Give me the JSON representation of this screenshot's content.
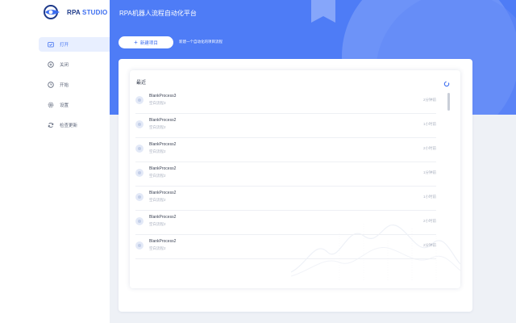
{
  "brand": {
    "name_main": "RPA",
    "name_accent": "STUDIO",
    "colors": {
      "primary": "#4e7cf6",
      "dark": "#1e3a8a",
      "accent": "#3b6df0"
    }
  },
  "sidebar": {
    "items": [
      {
        "label": "打开",
        "icon": "folder-open-icon",
        "active": true
      },
      {
        "label": "关闭",
        "icon": "close-circle-icon",
        "active": false
      },
      {
        "label": "开始",
        "icon": "clock-icon",
        "active": false
      },
      {
        "label": "设置",
        "icon": "gear-icon",
        "active": false
      },
      {
        "label": "检查更新",
        "icon": "sync-icon",
        "active": false
      }
    ]
  },
  "header": {
    "title": "RPA机器人流程自动化平台"
  },
  "toolbar": {
    "new_label": "新建项目",
    "new_hint": "新建一个自动化的项目流程"
  },
  "recent": {
    "title": "最近",
    "items": [
      {
        "name": "BlankProcess3",
        "sub": "空白流程3",
        "time": "2分钟前"
      },
      {
        "name": "BlankProcess2",
        "sub": "空白流程2",
        "time": "1小时前"
      },
      {
        "name": "BlankProcess2",
        "sub": "空白流程2",
        "time": "2小时前"
      },
      {
        "name": "BlankProcess2",
        "sub": "空白流程2",
        "time": "1分钟前"
      },
      {
        "name": "BlankProcess2",
        "sub": "空白流程2",
        "time": "1小时前"
      },
      {
        "name": "BlankProcess2",
        "sub": "空白流程2",
        "time": "2小时前"
      },
      {
        "name": "BlankProcess2",
        "sub": "空白流程2",
        "time": "2分钟前"
      }
    ]
  }
}
